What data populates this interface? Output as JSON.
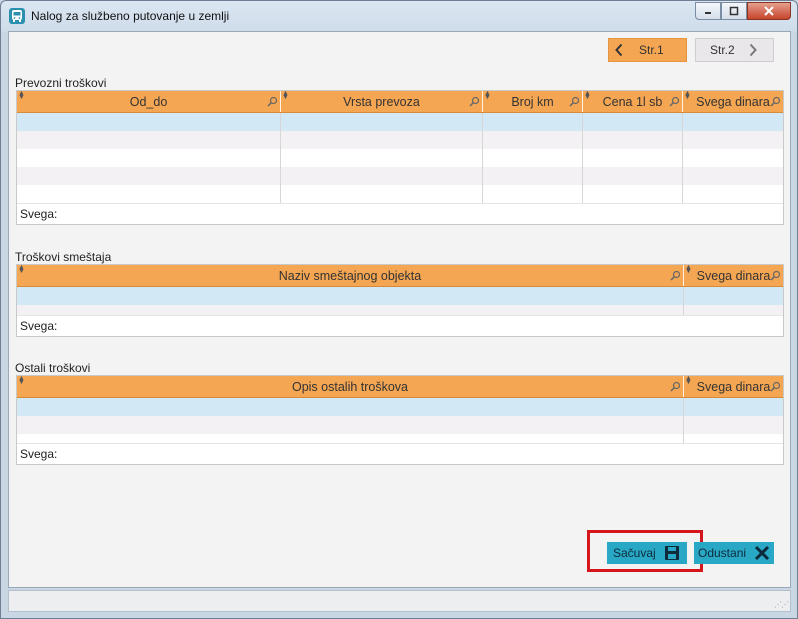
{
  "window": {
    "title": "Nalog za službeno putovanje u zemlji"
  },
  "pager": {
    "prev_label": "Str.1",
    "next_label": "Str.2"
  },
  "transport": {
    "label": "Prevozni troškovi",
    "columns": [
      "Od_do",
      "Vrsta prevoza",
      "Broj km",
      "Cena 1l sb",
      "Svega dinara"
    ],
    "footer": "Svega:"
  },
  "lodging": {
    "label": "Troškovi smeštaja",
    "columns": [
      "Naziv smeštajnog objekta",
      "Svega dinara"
    ],
    "footer": "Svega:"
  },
  "other": {
    "label": "Ostali troškovi",
    "columns": [
      "Opis ostalih troškova",
      "Svega dinara"
    ],
    "footer": "Svega:"
  },
  "actions": {
    "save_label": "Sačuvaj",
    "cancel_label": "Odustani"
  },
  "colors": {
    "header_orange": "#f5a653",
    "row_blue": "#d2e9f5",
    "button_teal": "#29a8c5",
    "highlight_red": "#d4161c"
  }
}
